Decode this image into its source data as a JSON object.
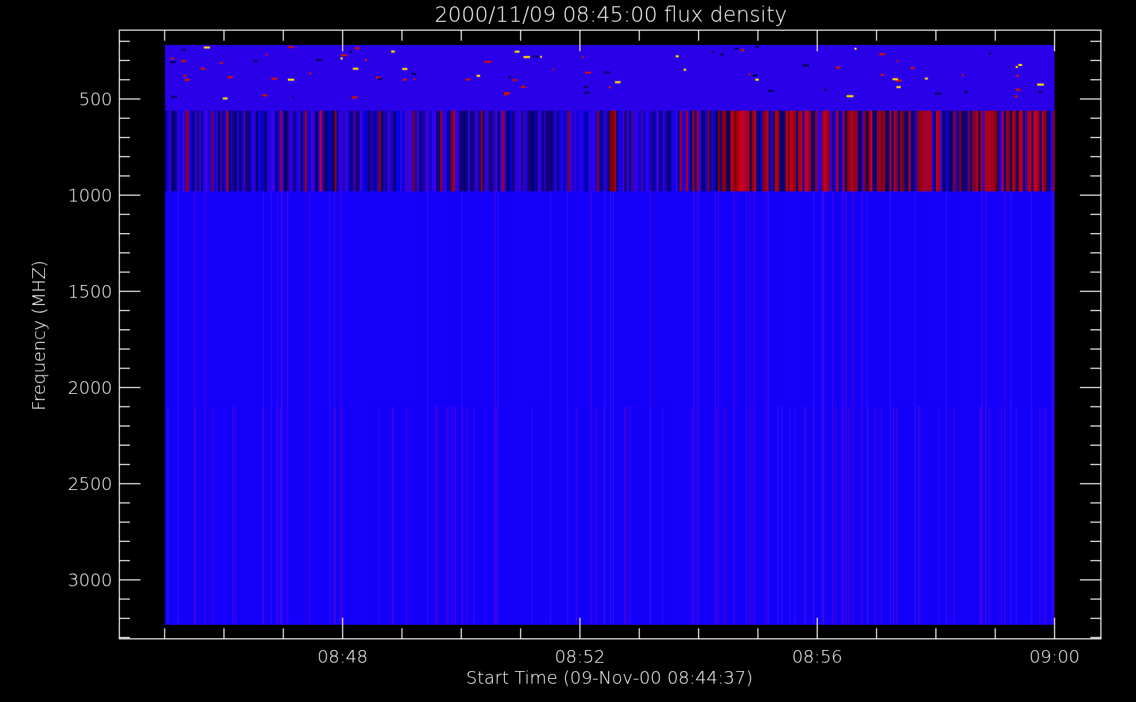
{
  "plot": {
    "title": "2000/11/09 08:45:00 flux density",
    "x_axis": {
      "label": "Start Time (09-Nov-00 08:44:37)",
      "tick_labels": [
        "08:48",
        "08:52",
        "08:56",
        "09:00"
      ]
    },
    "y_axis": {
      "label": "Frequency (MHZ)",
      "tick_labels": [
        "500",
        "1000",
        "1500",
        "2000",
        "2500",
        "3000"
      ]
    }
  }
}
